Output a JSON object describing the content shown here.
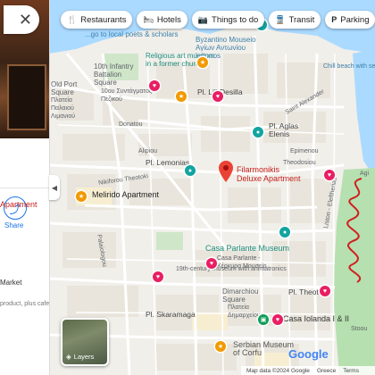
{
  "chips": [
    {
      "icon": "restaurant-icon",
      "glyph": "🍴",
      "label": "Restaurants"
    },
    {
      "icon": "hotel-icon",
      "glyph": "🛏",
      "label": "Hotels"
    },
    {
      "icon": "camera-icon",
      "glyph": "📷",
      "label": "Things to do"
    },
    {
      "icon": "transit-icon",
      "glyph": "🚆",
      "label": "Transit"
    },
    {
      "icon": "parking-icon",
      "glyph": "P",
      "label": "Parking"
    }
  ],
  "panel": {
    "close_glyph": "✕",
    "share_label": "Share",
    "apartment_text": "Apartment",
    "market_text": "Market",
    "product_text": "product, plus cafe",
    "collapse_glyph": "◀"
  },
  "map_labels": {
    "religious_art": "Religious art museum\nin a former church",
    "byzantino": "Byzantino Mouseio\nΑγίων Αντωνίου\nkritonos",
    "infantry": "10th Infantry\nBattalion\nSquare",
    "infantry_gr": "10ου Συντάγματος\nΠεζικού",
    "old_port": "Old Port\nSquare",
    "old_port_gr": "Πλατεία\nΠαλαιού\nΛιμανιού",
    "pl_lili": "Pl. Lili Desilla",
    "aglas": "Pl. Aglas\nElenis",
    "pl_lemonia": "Pl. Lemonias",
    "filarmonikis": "Filarmonikis\nDeluxe Apartment",
    "melirido": "Melirido Apartment",
    "casa_parlante": "Casa Parlante Museum",
    "casa_parlante_gr": "Casa Parlante -\nΚέρκυρα Μουσείο",
    "casa_19": "19th-century museum with animatronics",
    "dimarchiou": "Dimarchiou\nSquare",
    "dimarchiou_gr": "Πλατεία\nΔημαρχείου",
    "pl_theotoki": "Pl. Theotoki",
    "pl_skaramaga": "Pl. Skaramaga",
    "casa_iolanda": "Casa Iolanda I & II",
    "serbian": "Serbian Museum\nof Corfu",
    "chill": "Chill beach with sea",
    "lisson": "Liston - Eleftherias",
    "palaiologou": "Palaiologou",
    "nikiforou": "Nikiforou Theotoki",
    "theodosiou": "Theodosiou",
    "epimenou": "Epimenou",
    "alipiou": "Alipiou",
    "fanou": "Fanou",
    "saint": "Saint Alexander",
    "stoou": "Stoou",
    "donatou": "Donatou",
    "scholars_top": "...go to local poets & scholars",
    "agi": "Agi"
  },
  "layers_label": "Layers",
  "google_logo": "Google",
  "footer": {
    "map_data": "Map data ©2024 Google",
    "country": "Greece",
    "terms": "Terms"
  },
  "colors": {
    "pin_red": "#ea4335",
    "park_green": "#b6e0b0",
    "water_blue": "#aadaff",
    "squiggle": "#d01f1f"
  }
}
